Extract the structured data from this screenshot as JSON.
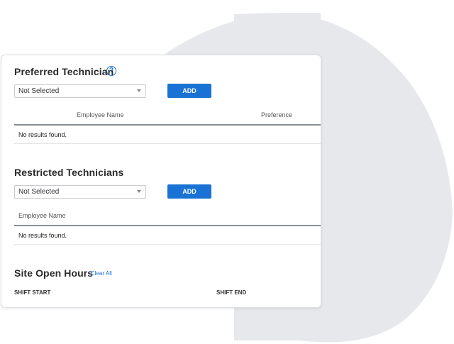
{
  "preferred": {
    "title": "Preferred Technician",
    "help_icon": "question-circle-icon",
    "select_value": "Not Selected",
    "add_label": "ADD",
    "columns": [
      "Employee Name",
      "Preference"
    ],
    "empty_text": "No results found."
  },
  "restricted": {
    "title": "Restricted Technicians",
    "select_value": "Not Selected",
    "add_label": "ADD",
    "columns": [
      "Employee Name"
    ],
    "empty_text": "No results found."
  },
  "hours": {
    "title": "Site Open Hours",
    "clear_label": "Clear All",
    "columns": [
      "SHIFT START",
      "SHIFT END"
    ]
  },
  "colors": {
    "accent": "#1a73d4",
    "background_shape": "#e6e8eb"
  }
}
